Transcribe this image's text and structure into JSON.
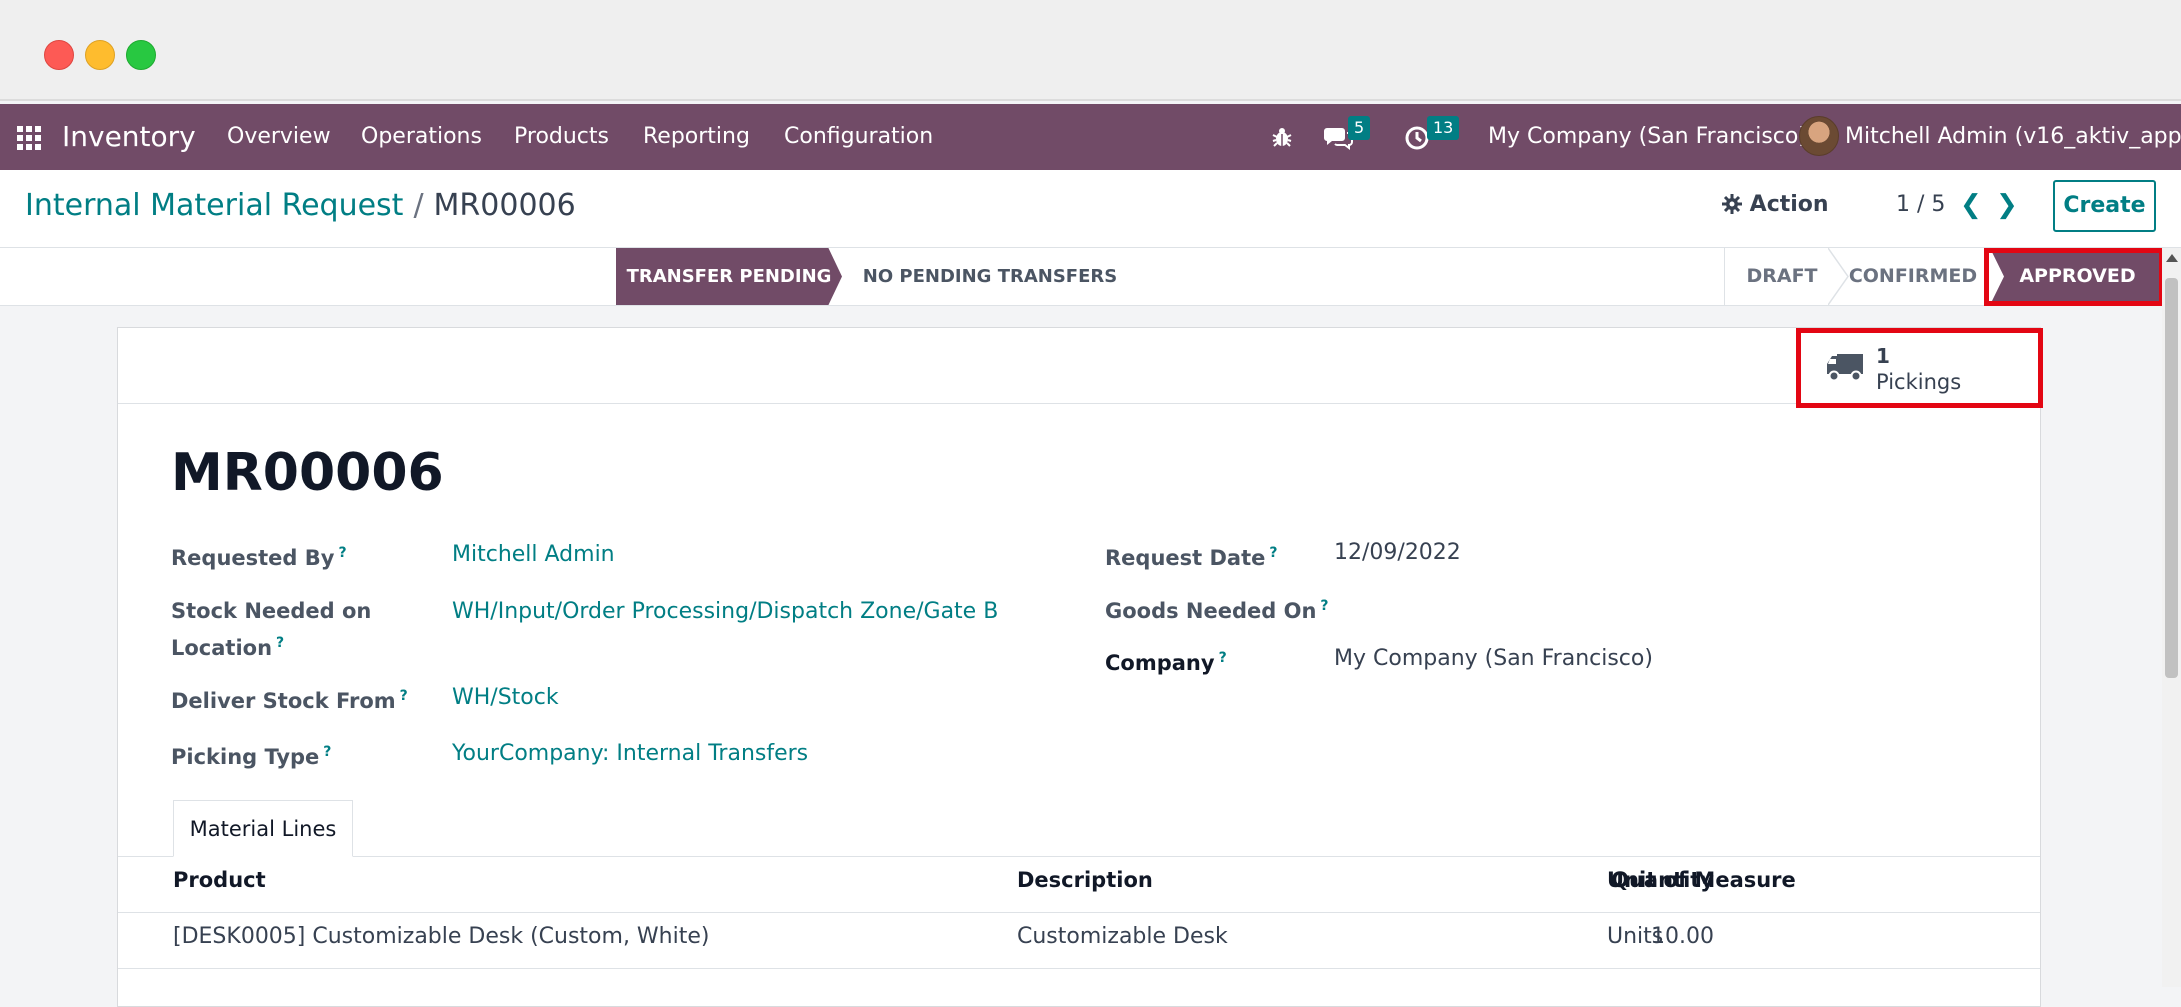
{
  "navbar": {
    "app_name": "Inventory",
    "menu": [
      "Overview",
      "Operations",
      "Products",
      "Reporting",
      "Configuration"
    ],
    "messages_badge": "5",
    "activities_badge": "13",
    "company": "My Company (San Francisco)",
    "user": "Mitchell Admin (v16_aktiv_apps)"
  },
  "breadcrumb": {
    "parent": "Internal Material Request",
    "separator": "/",
    "current": "MR00006"
  },
  "control": {
    "action_label": "Action",
    "pager": "1 / 5",
    "create_label": "Create"
  },
  "statusbar": {
    "transfer_pending": "TRANSFER PENDING",
    "no_pending": "NO PENDING TRANSFERS",
    "stages": [
      "DRAFT",
      "CONFIRMED",
      "APPROVED"
    ],
    "active_stage": "APPROVED"
  },
  "smart_button": {
    "value": "1",
    "label": "Pickings",
    "icon": "truck-icon"
  },
  "form": {
    "name": "MR00006",
    "requested_by_label": "Requested By",
    "requested_by": "Mitchell Admin",
    "stock_needed_label_1": "Stock Needed on",
    "stock_needed_label_2": "Location",
    "stock_needed": "WH/Input/Order Processing/Dispatch Zone/Gate B",
    "deliver_from_label": "Deliver Stock From",
    "deliver_from": "WH/Stock",
    "picking_type_label": "Picking Type",
    "picking_type": "YourCompany: Internal Transfers",
    "request_date_label": "Request Date",
    "request_date": "12/09/2022",
    "goods_needed_label": "Goods Needed On",
    "company_label": "Company",
    "company": "My Company (San Francisco)",
    "help_mark": "?"
  },
  "tabs": {
    "material_lines": "Material Lines"
  },
  "table": {
    "headers": [
      "Product",
      "Description",
      "Quantity",
      "Unit of Measure"
    ],
    "rows": [
      [
        "[DESK0005] Customizable Desk (Custom, White)",
        "Customizable Desk",
        "10.00",
        "Units"
      ]
    ]
  },
  "colors": {
    "brand": "#714b67",
    "accent": "#017e84",
    "highlight": "#e30613"
  }
}
